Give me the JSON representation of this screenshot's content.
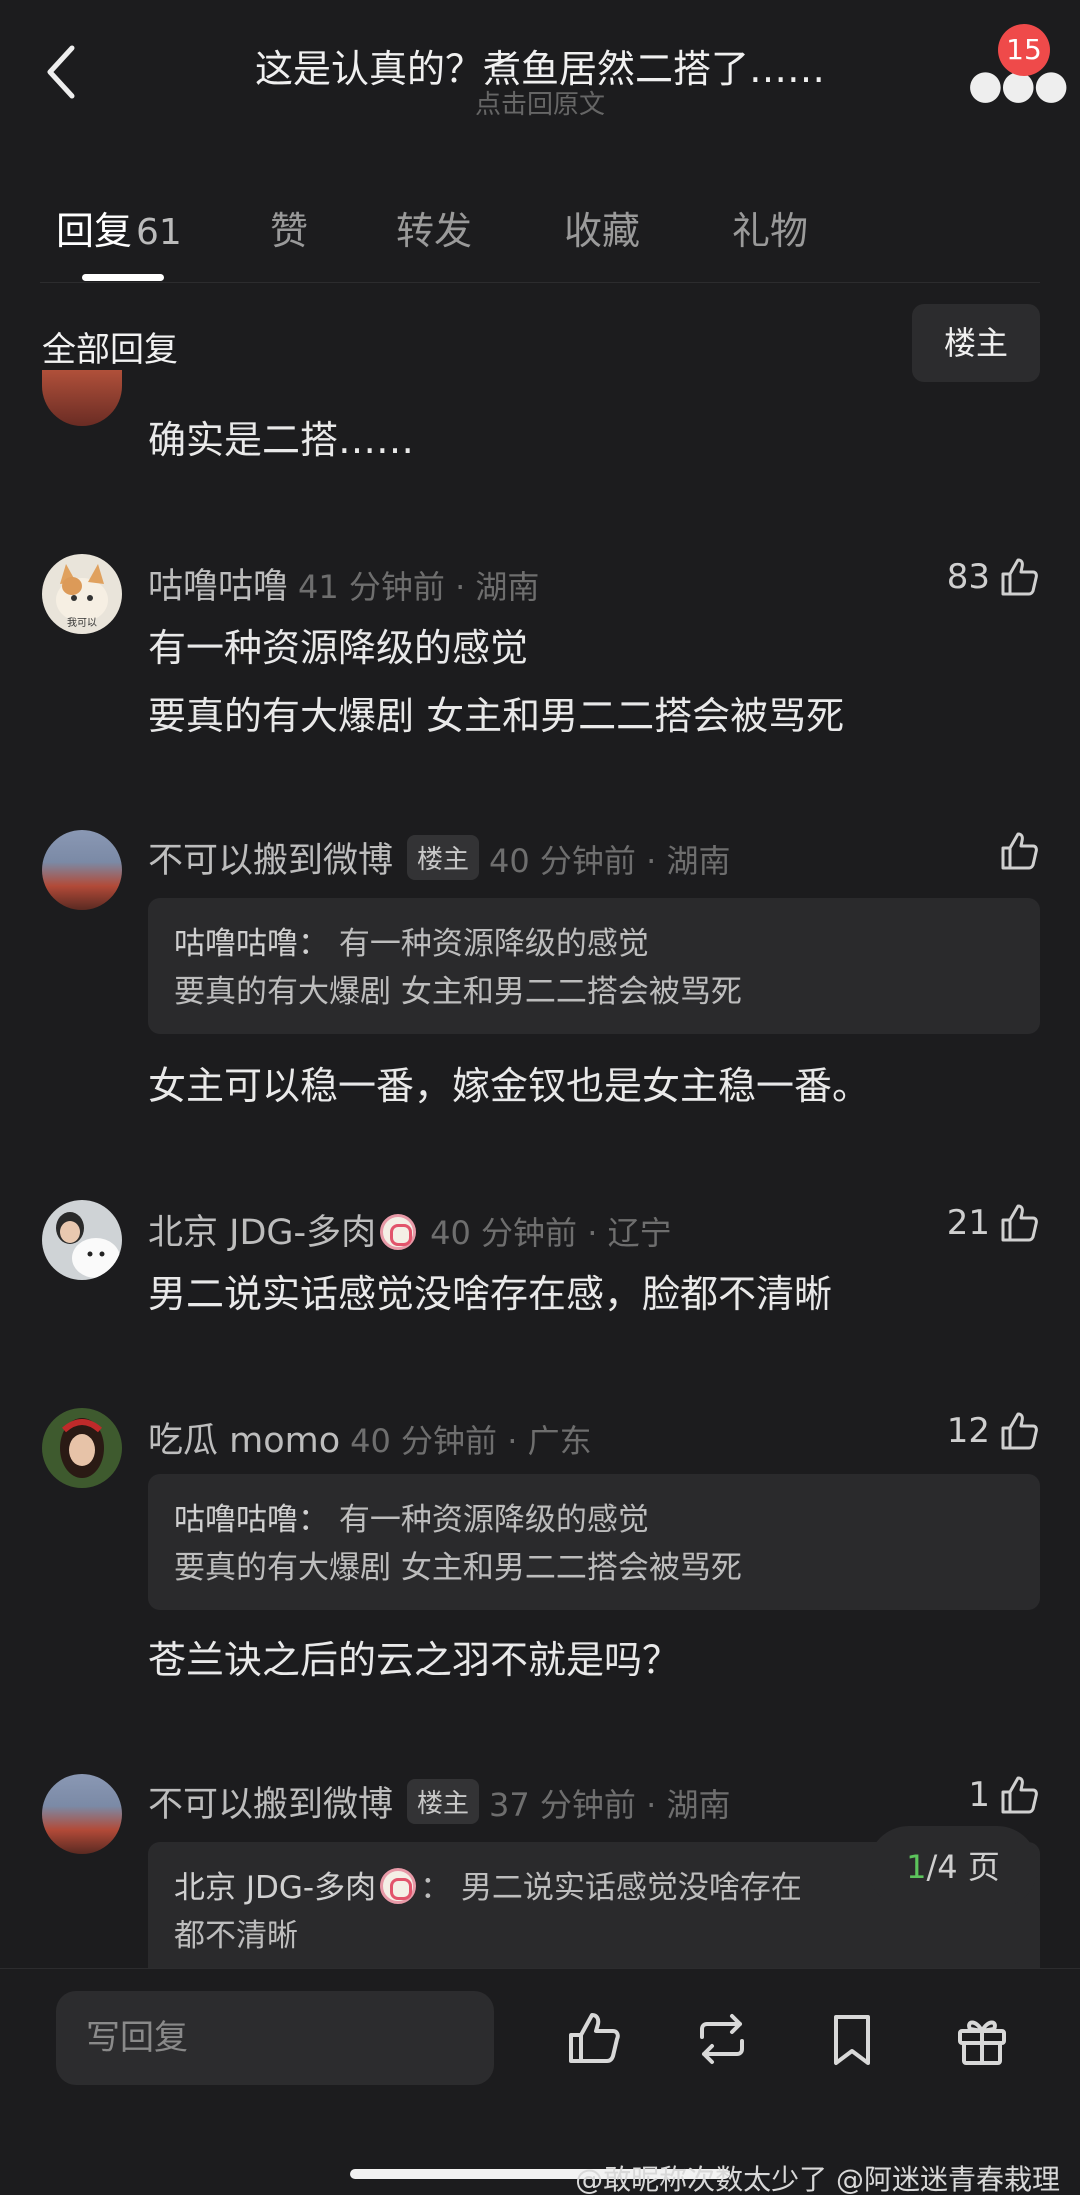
{
  "header": {
    "title": "这是认真的？煮鱼居然二搭了……",
    "subtitle": "点击回原文",
    "badge": "15"
  },
  "tabs": [
    {
      "label": "回复",
      "count": "61"
    },
    {
      "label": "赞"
    },
    {
      "label": "转发"
    },
    {
      "label": "收藏"
    },
    {
      "label": "礼物"
    }
  ],
  "section": {
    "title": "全部回复",
    "owner_filter": "楼主"
  },
  "comments": [
    {
      "text": [
        "确实是二搭……"
      ]
    },
    {
      "user": "咕噜咕噜",
      "meta": "41 分钟前 · 湖南",
      "likes": "83",
      "avatar_caption": "我可以",
      "text": [
        "有一种资源降级的感觉",
        "要真的有大爆剧 女主和男二二搭会被骂死"
      ]
    },
    {
      "user": "不可以搬到微博",
      "tag": "楼主",
      "meta": "40 分钟前 · 湖南",
      "likes": "",
      "quote": {
        "name": "咕噜咕噜：",
        "lines": [
          "有一种资源降级的感觉",
          "要真的有大爆剧 女主和男二二搭会被骂死"
        ]
      },
      "text": [
        "女主可以稳一番，嫁金钗也是女主稳一番。"
      ]
    },
    {
      "user": "北京 JDG-多肉",
      "meta": "40 分钟前 · 辽宁",
      "likes": "21",
      "text": [
        "男二说实话感觉没啥存在感，脸都不清晰"
      ]
    },
    {
      "user": "吃瓜 momo",
      "meta": "40 分钟前 · 广东",
      "likes": "12",
      "quote": {
        "name": "咕噜咕噜：",
        "lines": [
          "有一种资源降级的感觉",
          "要真的有大爆剧 女主和男二二搭会被骂死"
        ]
      },
      "text": [
        "苍兰诀之后的云之羽不就是吗？"
      ]
    },
    {
      "user": "不可以搬到微博",
      "tag": "楼主",
      "meta": "37 分钟前 · 湖南",
      "likes": "1",
      "quote": {
        "name": "北京 JDG-多肉",
        "sep": "：",
        "lines": [
          "男二说实话感觉没啥存在",
          "都不清晰"
        ]
      }
    }
  ],
  "pager": {
    "current": "1",
    "total": "/4 页"
  },
  "bottom_bar": {
    "reply_placeholder": "写回复"
  },
  "watermark": "@敢昵称次数太少了 @阿迷迷青春栽理"
}
